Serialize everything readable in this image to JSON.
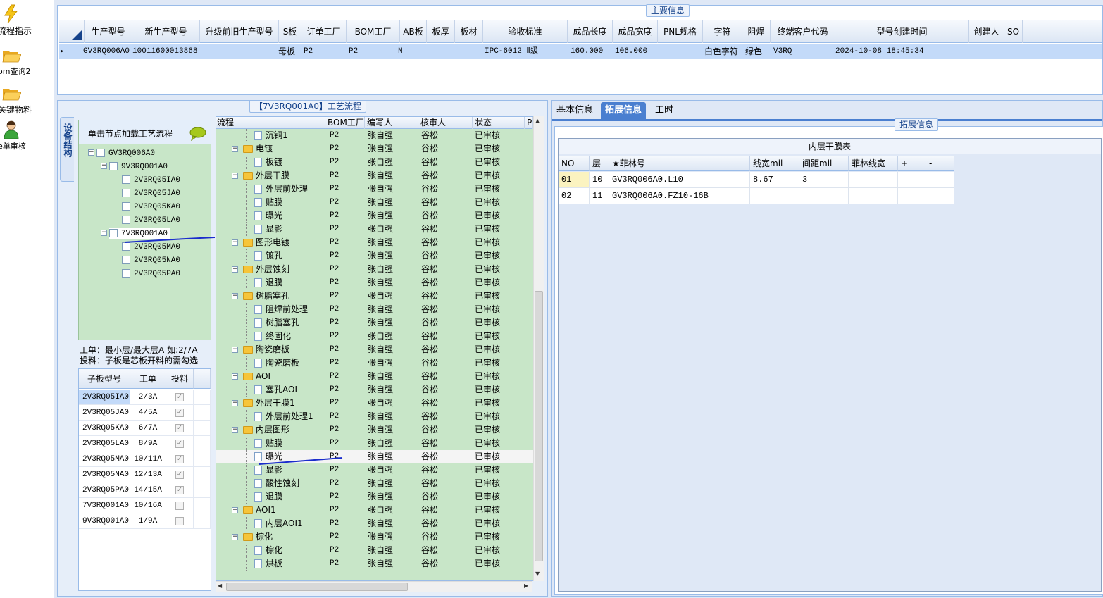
{
  "nav": [
    {
      "label": "流程指示",
      "icon": "lightning-icon"
    },
    {
      "label": "om查询2",
      "icon": "open-folder-icon"
    },
    {
      "label": "关键物料",
      "icon": "open-folder-icon"
    },
    {
      "label": "e单审核",
      "icon": "user-icon"
    }
  ],
  "main_info": {
    "title": "主要信息",
    "columns": [
      "生产型号",
      "新生产型号",
      "升级前旧生产型号",
      "S板",
      "订单工厂",
      "BOM工厂",
      "AB板",
      "板厚",
      "板材",
      "验收标准",
      "成品长度",
      "成品宽度",
      "PNL规格",
      "字符",
      "阻焊",
      "终端客户代码",
      "型号创建时间",
      "创建人",
      "SO"
    ],
    "row": {
      "生产型号": "GV3RQ006A0",
      "新生产型号": "10011600013868",
      "S板": "母板",
      "订单工厂": "P2",
      "BOM工厂": "P2",
      "AB板": "N",
      "验收标准": "IPC-6012 Ⅱ级",
      "成品长度": "160.000",
      "成品宽度": "106.000",
      "字符": "白色字符",
      "阻焊": "绿色",
      "终端客户代码": "V3RQ",
      "型号创建时间": "2024-10-08 18:45:34"
    }
  },
  "process": {
    "title": "【7V3RQ001A0】工艺流程",
    "side_tab": "设备结构",
    "tree_header": "单击节点加载工艺流程",
    "tree": [
      {
        "label": "GV3RQ006A0",
        "level": 0
      },
      {
        "label": "9V3RQ001A0",
        "level": 1
      },
      {
        "label": "2V3RQ05IA0",
        "level": 2
      },
      {
        "label": "2V3RQ05JA0",
        "level": 2
      },
      {
        "label": "2V3RQ05KA0",
        "level": 2
      },
      {
        "label": "2V3RQ05LA0",
        "level": 2
      },
      {
        "label": "7V3RQ001A0",
        "level": 1
      },
      {
        "label": "2V3RQ05MA0",
        "level": 2
      },
      {
        "label": "2V3RQ05NA0",
        "level": 2
      },
      {
        "label": "2V3RQ05PA0",
        "level": 2
      }
    ],
    "note_line1": "工单：最小层/最大层A 如:2/7A",
    "note_line2": "投料：子板是芯板开料的需勾选",
    "sub_columns": [
      "子板型号",
      "工单",
      "投料"
    ],
    "sub_rows": [
      {
        "model": "2V3RQ05IA0",
        "order": "2/3A",
        "checked": true
      },
      {
        "model": "2V3RQ05JA0",
        "order": "4/5A",
        "checked": true
      },
      {
        "model": "2V3RQ05KA0",
        "order": "6/7A",
        "checked": true
      },
      {
        "model": "2V3RQ05LA0",
        "order": "8/9A",
        "checked": true
      },
      {
        "model": "2V3RQ05MA0",
        "order": "10/11A",
        "checked": true
      },
      {
        "model": "2V3RQ05NA0",
        "order": "12/13A",
        "checked": true
      },
      {
        "model": "2V3RQ05PA0",
        "order": "14/15A",
        "checked": true
      },
      {
        "model": "7V3RQ001A0",
        "order": "10/16A",
        "checked": false
      },
      {
        "model": "9V3RQ001A0",
        "order": "1/9A",
        "checked": false
      }
    ],
    "columns": [
      "流程",
      "BOM工厂",
      "编写人",
      "核审人",
      "状态",
      "P"
    ],
    "rows": [
      {
        "name": "沉铜1",
        "type": "doc"
      },
      {
        "name": "电镀",
        "type": "folder"
      },
      {
        "name": "板镀",
        "type": "doc"
      },
      {
        "name": "外层干膜",
        "type": "folder"
      },
      {
        "name": "外层前处理",
        "type": "doc"
      },
      {
        "name": "贴膜",
        "type": "doc"
      },
      {
        "name": "曝光",
        "type": "doc"
      },
      {
        "name": "显影",
        "type": "doc"
      },
      {
        "name": "图形电镀",
        "type": "folder"
      },
      {
        "name": "镀孔",
        "type": "doc"
      },
      {
        "name": "外层蚀刻",
        "type": "folder"
      },
      {
        "name": "退膜",
        "type": "doc"
      },
      {
        "name": "树脂塞孔",
        "type": "folder"
      },
      {
        "name": "阻焊前处理",
        "type": "doc"
      },
      {
        "name": "树脂塞孔",
        "type": "doc"
      },
      {
        "name": "终固化",
        "type": "doc"
      },
      {
        "name": "陶瓷磨板",
        "type": "folder"
      },
      {
        "name": "陶瓷磨板",
        "type": "doc"
      },
      {
        "name": "AOI",
        "type": "folder"
      },
      {
        "name": "塞孔AOI",
        "type": "doc"
      },
      {
        "name": "外层干膜1",
        "type": "folder"
      },
      {
        "name": "外层前处理1",
        "type": "doc"
      },
      {
        "name": "内层图形",
        "type": "folder"
      },
      {
        "name": "贴膜",
        "type": "doc"
      },
      {
        "name": "曝光",
        "type": "doc",
        "selected": true
      },
      {
        "name": "显影",
        "type": "doc"
      },
      {
        "name": "酸性蚀刻",
        "type": "doc"
      },
      {
        "name": "退膜",
        "type": "doc"
      },
      {
        "name": "AOI1",
        "type": "folder"
      },
      {
        "name": "内层AOI1",
        "type": "doc"
      },
      {
        "name": "棕化",
        "type": "folder"
      },
      {
        "name": "棕化",
        "type": "doc"
      },
      {
        "name": "烘板",
        "type": "doc"
      }
    ],
    "factory": "P2",
    "writer": "张自强",
    "reviewer": "谷松",
    "status": "已审核"
  },
  "right": {
    "tabs": [
      "基本信息",
      "拓展信息",
      "工时"
    ],
    "active_tab": 1,
    "group_title": "拓展信息",
    "table_title": "内层干膜表",
    "columns": [
      "NO",
      "层",
      "★菲林号",
      "线宽mil",
      "间距mil",
      "菲林线宽",
      "+",
      "-"
    ],
    "rows": [
      {
        "no": "01",
        "layer": "10",
        "film": "GV3RQ006A0.L10",
        "width": "8.67",
        "gap": "3",
        "film_width": ""
      },
      {
        "no": "02",
        "layer": "11",
        "film": "GV3RQ006A0.FZ10-16B",
        "width": "",
        "gap": "",
        "film_width": ""
      }
    ]
  },
  "colors": {
    "accent": "#15428b",
    "selection": "#c3daf9",
    "green_panel": "#c8e6c8",
    "annotation_blue": "#1a2ccc",
    "annotation_red": "#e02020"
  }
}
